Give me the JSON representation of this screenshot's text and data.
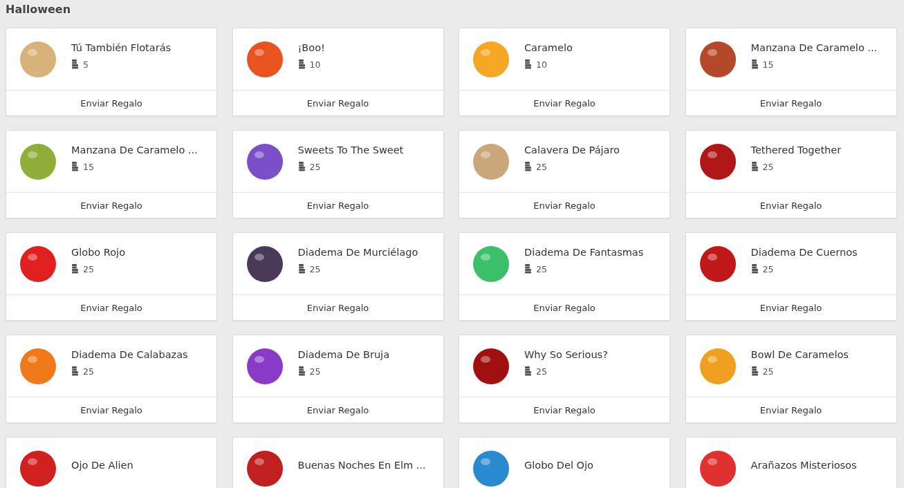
{
  "section_title": "Halloween",
  "gifts": [
    {
      "name": "Tú También Flotarás",
      "price": "5",
      "action": "Enviar Regalo"
    },
    {
      "name": "¡Boo!",
      "price": "10",
      "action": "Enviar Regalo"
    },
    {
      "name": "Caramelo",
      "price": "10",
      "action": "Enviar Regalo"
    },
    {
      "name": "Manzana De Caramelo ...",
      "price": "15",
      "action": "Enviar Regalo"
    },
    {
      "name": "Manzana De Caramelo ...",
      "price": "15",
      "action": "Enviar Regalo"
    },
    {
      "name": "Sweets To The Sweet",
      "price": "25",
      "action": "Enviar Regalo"
    },
    {
      "name": "Calavera De Pájaro",
      "price": "25",
      "action": "Enviar Regalo"
    },
    {
      "name": "Tethered Together",
      "price": "25",
      "action": "Enviar Regalo"
    },
    {
      "name": "Globo Rojo",
      "price": "25",
      "action": "Enviar Regalo"
    },
    {
      "name": "Diadema De Murciélago",
      "price": "25",
      "action": "Enviar Regalo"
    },
    {
      "name": "Diadema De Fantasmas",
      "price": "25",
      "action": "Enviar Regalo"
    },
    {
      "name": "Diadema De Cuernos",
      "price": "25",
      "action": "Enviar Regalo"
    },
    {
      "name": "Diadema De Calabazas",
      "price": "25",
      "action": "Enviar Regalo"
    },
    {
      "name": "Diadema De Bruja",
      "price": "25",
      "action": "Enviar Regalo"
    },
    {
      "name": "Why So Serious?",
      "price": "25",
      "action": "Enviar Regalo"
    },
    {
      "name": "Bowl De Caramelos",
      "price": "25",
      "action": "Enviar Regalo"
    },
    {
      "name": "Ojo De Alien"
    },
    {
      "name": "Buenas Noches En Elm ..."
    },
    {
      "name": "Globo Del Ojo"
    },
    {
      "name": "Arañazos Misteriosos"
    }
  ]
}
